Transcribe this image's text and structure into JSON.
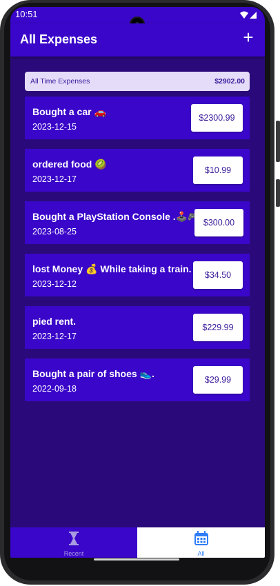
{
  "status_bar": {
    "time": "10:51"
  },
  "header": {
    "title": "All Expenses",
    "add_label": "+"
  },
  "summary": {
    "label": "All Time Expenses",
    "total": "$2902.00"
  },
  "expenses": [
    {
      "title": "Bought a car 🚗",
      "date": "2023-12-15",
      "amount": "$2300.99"
    },
    {
      "title": "ordered food 🥝",
      "date": "2023-12-17",
      "amount": "$10.99"
    },
    {
      "title": "Bought a PlayStation Console .🕹️🎮",
      "date": "2023-08-25",
      "amount": "$300.00"
    },
    {
      "title": "lost Money 💰 While taking a train.",
      "date": "2023-12-12",
      "amount": "$34.50"
    },
    {
      "title": "pied rent.",
      "date": "2023-12-17",
      "amount": "$229.99"
    },
    {
      "title": "Bought a pair of shoes 👟.",
      "date": "2022-09-18",
      "amount": "$29.99"
    }
  ],
  "bottom_nav": {
    "recent": {
      "label": "Recent",
      "icon": "hourglass-icon"
    },
    "all": {
      "label": "All",
      "icon": "calendar-icon"
    }
  },
  "colors": {
    "primary": "#3a06c9",
    "background": "#2a0a7a",
    "summary_bg": "#e4dcf9",
    "active_tab": "#2f7df7"
  }
}
